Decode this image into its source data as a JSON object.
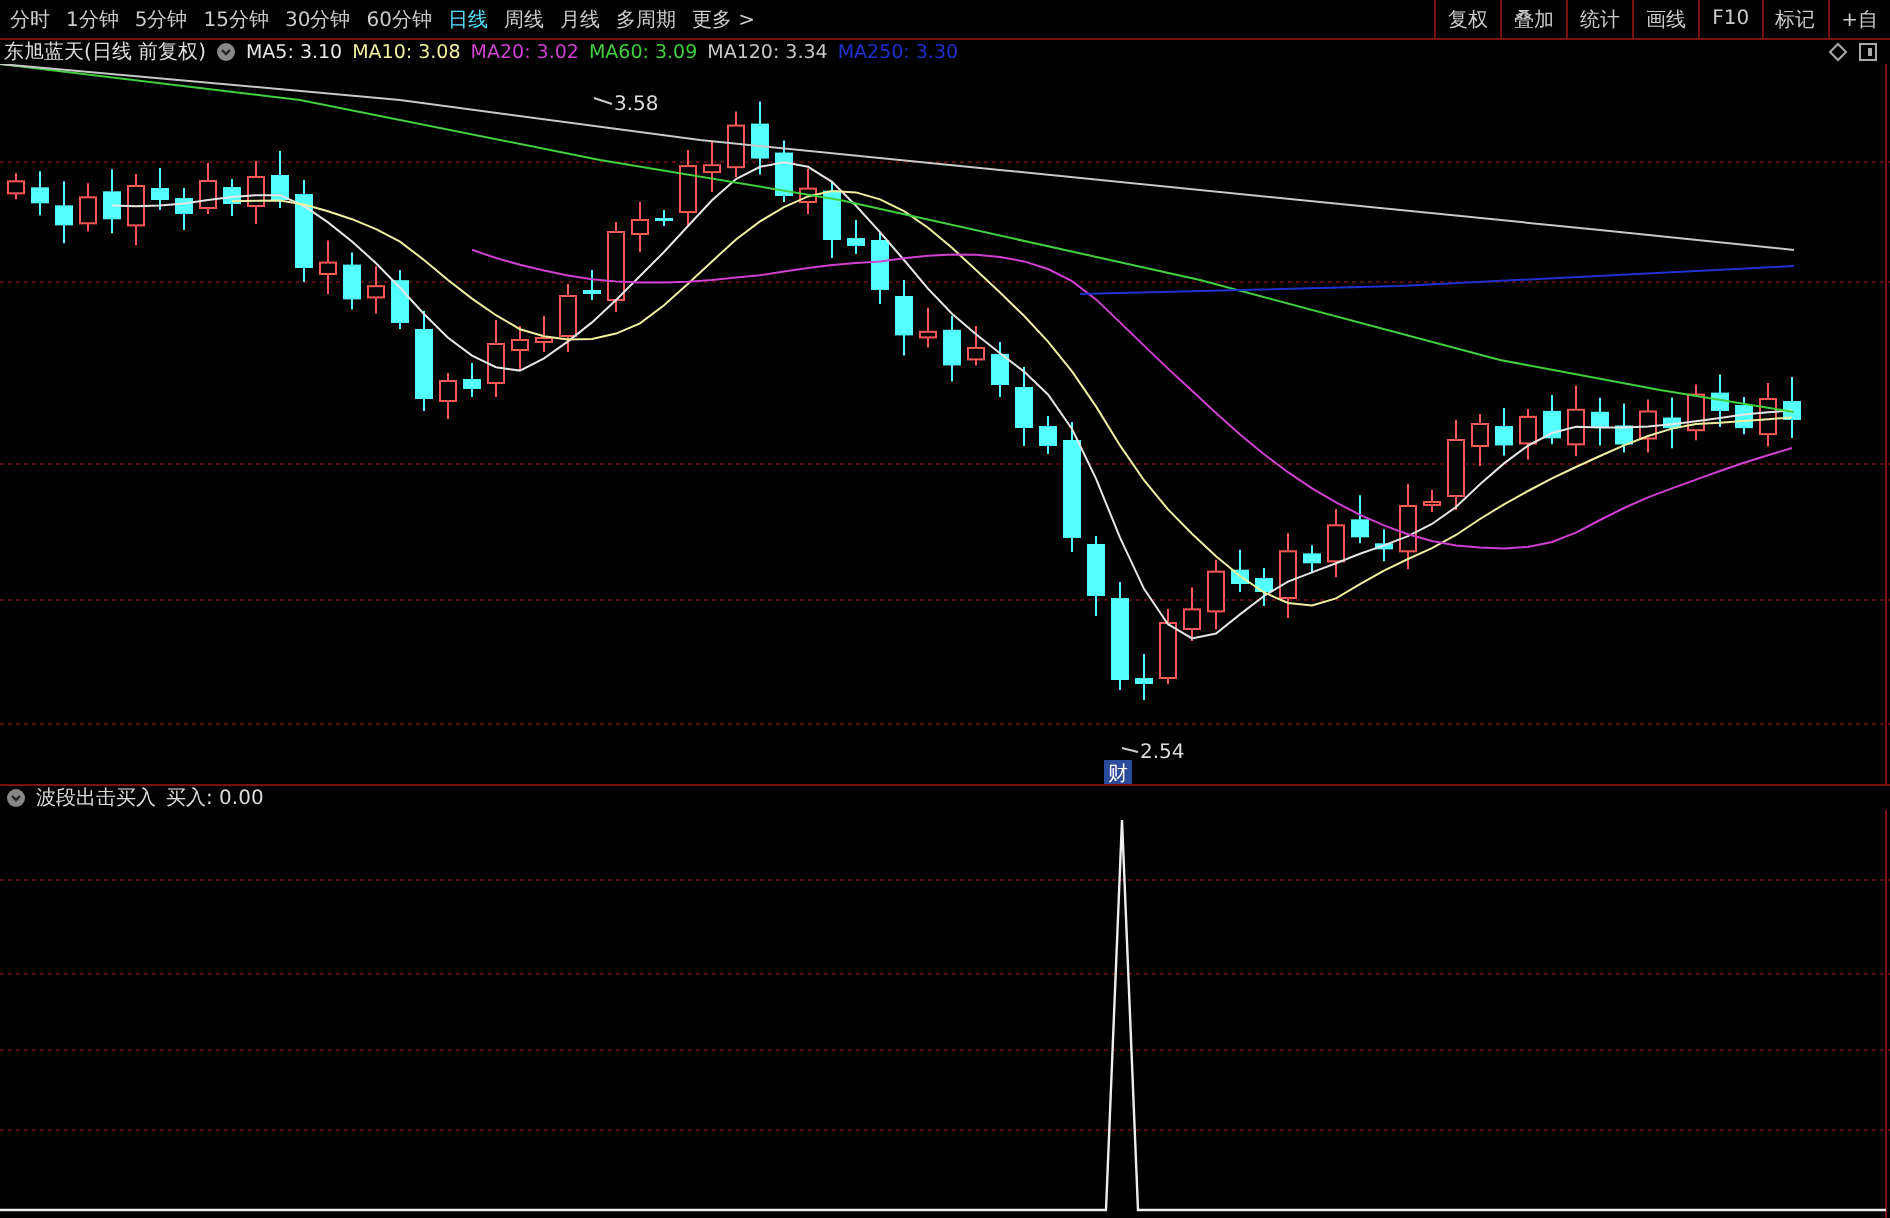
{
  "toolbar": {
    "periods": [
      {
        "label": "分时",
        "selected": false
      },
      {
        "label": "1分钟",
        "selected": false
      },
      {
        "label": "5分钟",
        "selected": false
      },
      {
        "label": "15分钟",
        "selected": false
      },
      {
        "label": "30分钟",
        "selected": false
      },
      {
        "label": "60分钟",
        "selected": false
      },
      {
        "label": "日线",
        "selected": true
      },
      {
        "label": "周线",
        "selected": false
      },
      {
        "label": "月线",
        "selected": false
      },
      {
        "label": "多周期",
        "selected": false
      }
    ],
    "more": "更多 >",
    "actions": [
      "复权",
      "叠加",
      "统计",
      "画线",
      "F10",
      "标记",
      "+自"
    ]
  },
  "main_chart": {
    "title": "东旭蓝天(日线 前复权)",
    "ma_legend": [
      {
        "label": "MA5: 3.10",
        "color": "#e6e6e6"
      },
      {
        "label": "MA10: 3.08",
        "color": "#f0f0a0"
      },
      {
        "label": "MA20: 3.02",
        "color": "#d040d0"
      },
      {
        "label": "MA60: 3.09",
        "color": "#40d040"
      },
      {
        "label": "MA120: 3.34",
        "color": "#c8c8c8"
      },
      {
        "label": "MA250: 3.30",
        "color": "#2030d0"
      }
    ],
    "high_label": "3.58",
    "low_label": "2.54",
    "badge": "财"
  },
  "indicator": {
    "title": "波段出击买入",
    "reading": "买入: 0.00"
  }
}
